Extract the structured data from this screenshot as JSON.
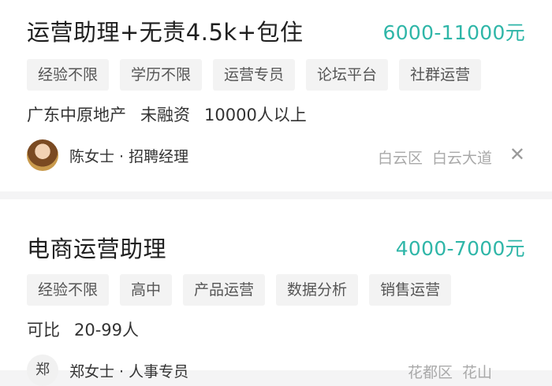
{
  "jobs": [
    {
      "title": "运营助理+无责4.5k+包住",
      "salary": "6000-11000元",
      "tags": [
        "经验不限",
        "学历不限",
        "运营专员",
        "论坛平台",
        "社群运营"
      ],
      "company": {
        "name": "广东中原地产",
        "stage": "未融资",
        "size": "10000人以上"
      },
      "recruiter": {
        "name": "陈女士 · 招聘经理"
      },
      "location": {
        "district": "白云区",
        "area": "白云大道"
      }
    },
    {
      "title": "电商运营助理",
      "salary": "4000-7000元",
      "tags": [
        "经验不限",
        "高中",
        "产品运营",
        "数据分析",
        "销售运营"
      ],
      "company": {
        "name": "可比",
        "size": "20-99人"
      },
      "recruiter": {
        "name": "郑女士 · 人事专员",
        "avatar_text": "郑"
      },
      "location": {
        "district": "花都区",
        "area": "花山"
      }
    }
  ],
  "icons": {
    "close": "close-icon",
    "avatar": "avatar-photo"
  },
  "colors": {
    "salary": "#2fb6a8",
    "background": "#f4f4f5",
    "card": "#ffffff"
  }
}
